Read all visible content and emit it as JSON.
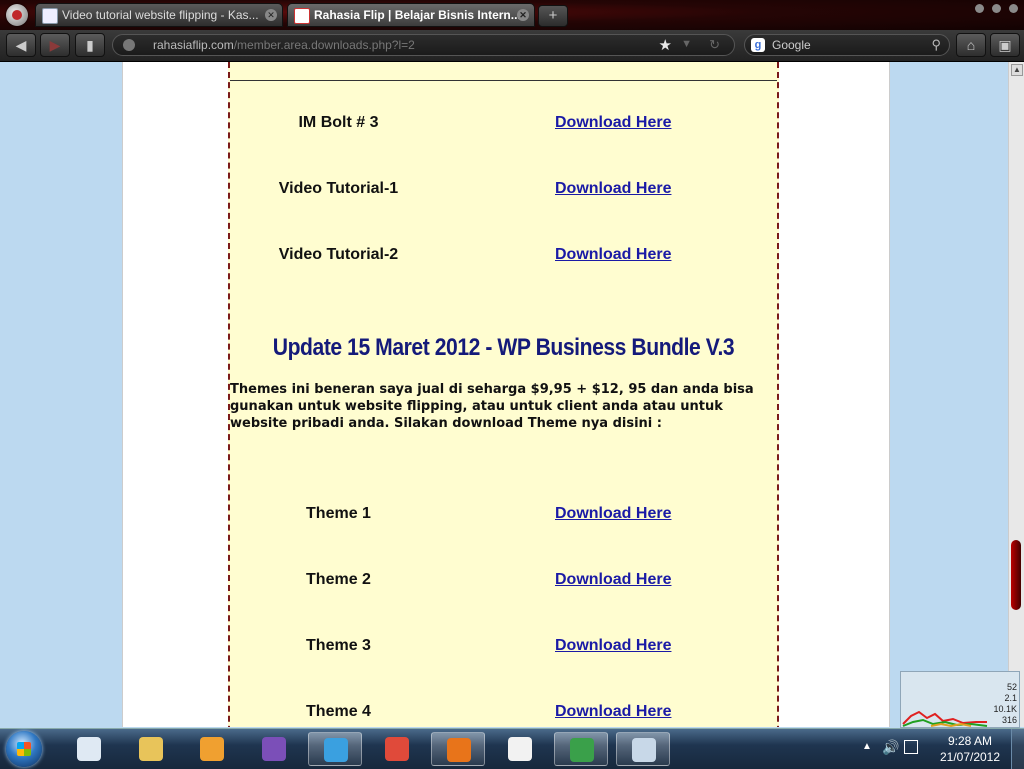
{
  "browser": {
    "tabs": [
      {
        "title": "Video tutorial website flipping - Kas...",
        "active": false
      },
      {
        "title": "Rahasia Flip | Belajar Bisnis Intern...",
        "active": true
      }
    ],
    "new_tab_label": "+",
    "url": {
      "host": "rahasiaflip.com",
      "path": "/member.area.downloads.php?l=2"
    },
    "search": {
      "engine_letter": "g",
      "placeholder": "Google"
    }
  },
  "page": {
    "top_rows": [
      {
        "name": "IM Bolt # 3",
        "link": "Download Here"
      },
      {
        "name": "Video Tutorial-1",
        "link": "Download Here"
      },
      {
        "name": "Video Tutorial-2",
        "link": "Download Here"
      }
    ],
    "update_heading": "Update 15 Maret 2012 - WP Business Bundle V.3",
    "update_text": "Themes ini beneran saya jual di seharga $9,95 + $12, 95 dan anda bisa gunakan untuk website flipping, atau untuk client anda atau untuk website pribadi anda. Silakan download Theme nya disini :",
    "theme_rows": [
      {
        "name": "Theme 1",
        "link": "Download Here"
      },
      {
        "name": "Theme 2",
        "link": "Download Here"
      },
      {
        "name": "Theme 3",
        "link": "Download Here"
      },
      {
        "name": "Theme 4",
        "link": "Download Here"
      }
    ]
  },
  "widget": {
    "stats": [
      "52",
      "2.1",
      "10.1K",
      "316"
    ]
  },
  "taskbar": {
    "apps": [
      {
        "name": "performance-monitor",
        "running": false,
        "color": "#dfe9f3"
      },
      {
        "name": "explorer",
        "running": false,
        "color": "#e8c45a"
      },
      {
        "name": "media-player",
        "running": false,
        "color": "#f0a030"
      },
      {
        "name": "visual-studio",
        "running": false,
        "color": "#7b4fb8"
      },
      {
        "name": "twitter",
        "running": true,
        "color": "#3aa0e0"
      },
      {
        "name": "chrome",
        "running": false,
        "color": "#e04a3a"
      },
      {
        "name": "firefox",
        "running": true,
        "color": "#e8741a"
      },
      {
        "name": "smartfren",
        "running": false,
        "color": "#f2f2f2"
      },
      {
        "name": "internet-download-manager",
        "running": true,
        "color": "#3aa04a"
      },
      {
        "name": "paint",
        "running": true,
        "color": "#c8d8e8"
      }
    ],
    "clock": {
      "time": "9:28 AM",
      "date": "21/07/2012"
    }
  }
}
